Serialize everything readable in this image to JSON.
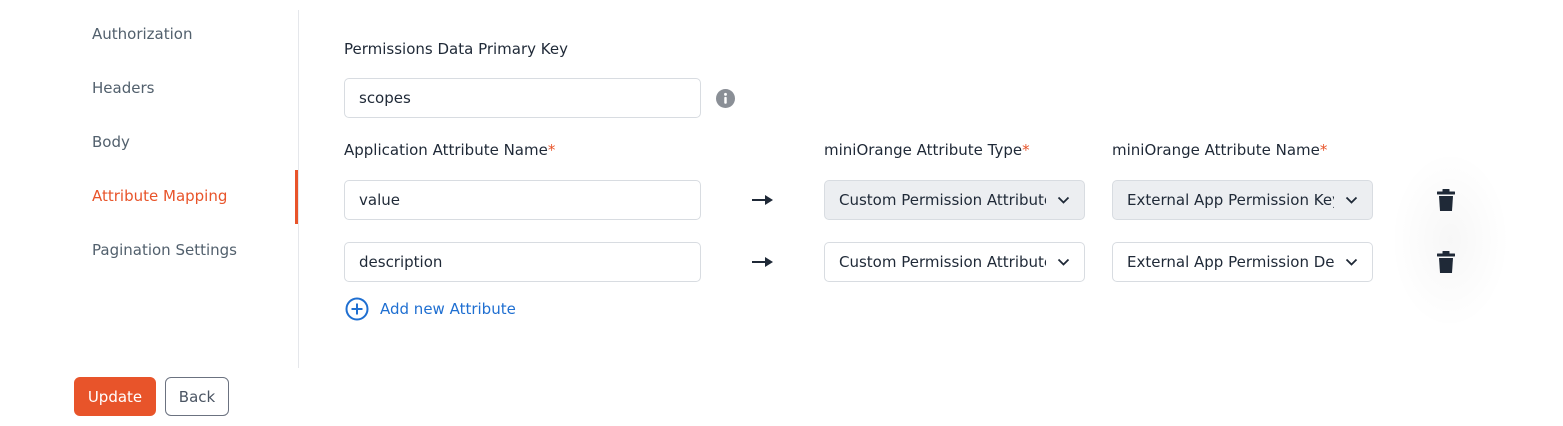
{
  "sidebar": {
    "items": [
      {
        "label": "Authorization",
        "active": false
      },
      {
        "label": "Headers",
        "active": false
      },
      {
        "label": "Body",
        "active": false
      },
      {
        "label": "Attribute Mapping",
        "active": true
      },
      {
        "label": "Pagination Settings",
        "active": false
      }
    ]
  },
  "actions": {
    "update_label": "Update",
    "back_label": "Back"
  },
  "main": {
    "primary_key_label": "Permissions Data Primary Key",
    "primary_key_value": "scopes",
    "columns": {
      "app_attr": "Application Attribute Name",
      "mo_type": "miniOrange Attribute Type",
      "mo_name": "miniOrange Attribute Name",
      "required_mark": "*"
    },
    "rows": [
      {
        "app_attr_value": "value",
        "mo_type": "Custom Permission Attribute",
        "mo_name": "External App Permission Key",
        "disabled": true
      },
      {
        "app_attr_value": "description",
        "mo_type": "Custom Permission Attribute",
        "mo_name": "External App Permission Description",
        "disabled": false
      }
    ],
    "add_attribute_label": "Add new Attribute"
  },
  "colors": {
    "accent": "#e8542a",
    "link": "#1f6fd1",
    "disabled_bg": "#eceef1"
  },
  "icons": [
    "info-icon",
    "arrow-right-icon",
    "chevron-down-icon",
    "trash-icon",
    "plus-circle-icon"
  ]
}
